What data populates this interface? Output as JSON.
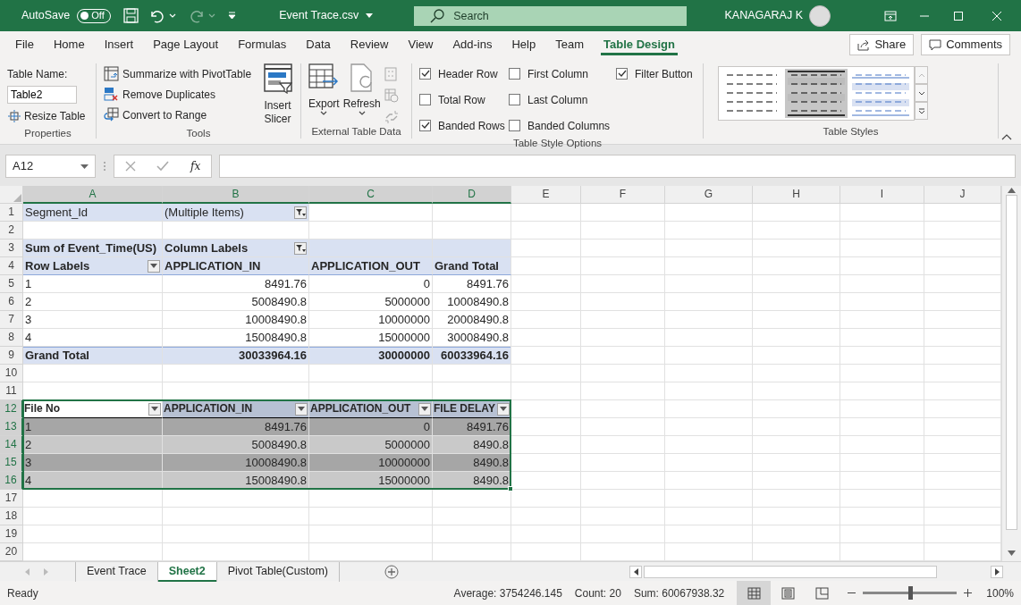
{
  "title_bar": {
    "autosave_label": "AutoSave",
    "autosave": {
      "on": false,
      "label": "Off"
    },
    "file_name": "Event Trace.csv",
    "search_placeholder": "Search",
    "user": "KANAGARAJ K"
  },
  "ribbon_tabs": [
    {
      "label": "File",
      "selected": false
    },
    {
      "label": "Home",
      "selected": false
    },
    {
      "label": "Insert",
      "selected": false
    },
    {
      "label": "Page Layout",
      "selected": false
    },
    {
      "label": "Formulas",
      "selected": false
    },
    {
      "label": "Data",
      "selected": false
    },
    {
      "label": "Review",
      "selected": false
    },
    {
      "label": "View",
      "selected": false
    },
    {
      "label": "Add-ins",
      "selected": false
    },
    {
      "label": "Help",
      "selected": false
    },
    {
      "label": "Team",
      "selected": false
    },
    {
      "label": "Table Design",
      "selected": true
    }
  ],
  "share": "Share",
  "comments": "Comments",
  "ribbon": {
    "properties": {
      "title": "Properties",
      "name_label": "Table Name:",
      "name_value": "Table2",
      "resize": "Resize Table"
    },
    "tools": {
      "title": "Tools",
      "items": [
        "Summarize with PivotTable",
        "Remove Duplicates",
        "Convert to Range"
      ],
      "slicer": "Insert Slicer"
    },
    "external": {
      "title": "External Table Data",
      "export": "Export",
      "refresh": "Refresh"
    },
    "style_options": {
      "title": "Table Style Options",
      "options": [
        {
          "label": "Header Row",
          "checked": true
        },
        {
          "label": "Total Row",
          "checked": false
        },
        {
          "label": "Banded Rows",
          "checked": true
        },
        {
          "label": "First Column",
          "checked": false
        },
        {
          "label": "Last Column",
          "checked": false
        },
        {
          "label": "Banded Columns",
          "checked": false
        },
        {
          "label": "Filter Button",
          "checked": true
        }
      ]
    },
    "table_styles": {
      "title": "Table Styles",
      "styles": [
        {
          "kind": "plain",
          "selected": false
        },
        {
          "kind": "gray",
          "selected": true
        },
        {
          "kind": "blue",
          "selected": false
        }
      ]
    }
  },
  "formula_bar": {
    "cell": "A12",
    "fx": "fx"
  },
  "columns": [
    {
      "label": "A",
      "selected": true
    },
    {
      "label": "B",
      "selected": true
    },
    {
      "label": "C",
      "selected": true
    },
    {
      "label": "D",
      "selected": true
    },
    {
      "label": "E",
      "selected": false
    },
    {
      "label": "F",
      "selected": false
    },
    {
      "label": "G",
      "selected": false
    },
    {
      "label": "H",
      "selected": false
    },
    {
      "label": "I",
      "selected": false
    },
    {
      "label": "J",
      "selected": false
    }
  ],
  "rows": [
    {
      "label": "1",
      "selected": false,
      "kind": "pivot-filter",
      "cells": [
        {
          "text": "Segment_Id",
          "kind": "text"
        },
        {
          "text": "(Multiple Items)",
          "kind": "text",
          "filter": {
            "kind": "funnel"
          }
        }
      ]
    },
    {
      "label": "2",
      "selected": false,
      "kind": "blank",
      "cells": []
    },
    {
      "label": "3",
      "selected": false,
      "kind": "pivot-head",
      "cells": [
        {
          "text": "Sum of Event_Time(US)",
          "kind": "text"
        },
        {
          "text": "Column Labels",
          "kind": "text",
          "filter": {
            "kind": "funnel"
          }
        }
      ]
    },
    {
      "label": "4",
      "selected": false,
      "kind": "pivot-labels",
      "cells": [
        {
          "text": "Row Labels",
          "kind": "text",
          "filter": {
            "kind": "dropdown"
          }
        },
        {
          "text": "APPLICATION_IN",
          "kind": "text"
        },
        {
          "text": "APPLICATION_OUT",
          "kind": "text"
        },
        {
          "text": "Grand Total",
          "kind": "text"
        }
      ]
    },
    {
      "label": "5",
      "selected": false,
      "kind": "pivot-data",
      "cells": [
        {
          "text": "1",
          "kind": "text"
        },
        {
          "text": "8491.76",
          "kind": "number"
        },
        {
          "text": "0",
          "kind": "number"
        },
        {
          "text": "8491.76",
          "kind": "number"
        }
      ]
    },
    {
      "label": "6",
      "selected": false,
      "kind": "pivot-data",
      "cells": [
        {
          "text": "2",
          "kind": "text"
        },
        {
          "text": "5008490.8",
          "kind": "number"
        },
        {
          "text": "5000000",
          "kind": "number"
        },
        {
          "text": "10008490.8",
          "kind": "number"
        }
      ]
    },
    {
      "label": "7",
      "selected": false,
      "kind": "pivot-data",
      "cells": [
        {
          "text": "3",
          "kind": "text"
        },
        {
          "text": "10008490.8",
          "kind": "number"
        },
        {
          "text": "10000000",
          "kind": "number"
        },
        {
          "text": "20008490.8",
          "kind": "number"
        }
      ]
    },
    {
      "label": "8",
      "selected": false,
      "kind": "pivot-data",
      "cells": [
        {
          "text": "4",
          "kind": "text"
        },
        {
          "text": "15008490.8",
          "kind": "number"
        },
        {
          "text": "15000000",
          "kind": "number"
        },
        {
          "text": "30008490.8",
          "kind": "number"
        }
      ]
    },
    {
      "label": "9",
      "selected": false,
      "kind": "pivot-total",
      "cells": [
        {
          "text": "Grand Total",
          "kind": "text"
        },
        {
          "text": "30033964.16",
          "kind": "number"
        },
        {
          "text": "30000000",
          "kind": "number"
        },
        {
          "text": "60033964.16",
          "kind": "number"
        }
      ]
    },
    {
      "label": "10",
      "selected": false,
      "kind": "blank",
      "cells": []
    },
    {
      "label": "11",
      "selected": false,
      "kind": "blank",
      "cells": []
    },
    {
      "label": "12",
      "selected": true,
      "kind": "table-header",
      "cells": [
        {
          "text": "File No",
          "kind": "text",
          "active": true,
          "filter": {
            "kind": "dropdown"
          }
        },
        {
          "text": "APPLICATION_IN",
          "kind": "text",
          "active": false,
          "filter": {
            "kind": "dropdown"
          }
        },
        {
          "text": "APPLICATION_OUT",
          "kind": "text",
          "active": false,
          "filter": {
            "kind": "dropdown"
          }
        },
        {
          "text": "FILE DELAY",
          "kind": "text",
          "active": false,
          "filter": {
            "kind": "dropdown"
          }
        }
      ]
    },
    {
      "label": "13",
      "selected": true,
      "kind": "band-dark",
      "cells": [
        {
          "text": "1",
          "kind": "text"
        },
        {
          "text": "8491.76",
          "kind": "number"
        },
        {
          "text": "0",
          "kind": "number"
        },
        {
          "text": "8491.76",
          "kind": "number"
        }
      ]
    },
    {
      "label": "14",
      "selected": true,
      "kind": "band-light",
      "cells": [
        {
          "text": "2",
          "kind": "text"
        },
        {
          "text": "5008490.8",
          "kind": "number"
        },
        {
          "text": "5000000",
          "kind": "number"
        },
        {
          "text": "8490.8",
          "kind": "number"
        }
      ]
    },
    {
      "label": "15",
      "selected": true,
      "kind": "band-dark",
      "cells": [
        {
          "text": "3",
          "kind": "text"
        },
        {
          "text": "10008490.8",
          "kind": "number"
        },
        {
          "text": "10000000",
          "kind": "number"
        },
        {
          "text": "8490.8",
          "kind": "number"
        }
      ]
    },
    {
      "label": "16",
      "selected": true,
      "kind": "band-light",
      "cells": [
        {
          "text": "4",
          "kind": "text"
        },
        {
          "text": "15008490.8",
          "kind": "number"
        },
        {
          "text": "15000000",
          "kind": "number"
        },
        {
          "text": "8490.8",
          "kind": "number"
        }
      ]
    },
    {
      "label": "17",
      "selected": false,
      "kind": "blank",
      "cells": []
    },
    {
      "label": "18",
      "selected": false,
      "kind": "blank",
      "cells": []
    },
    {
      "label": "19",
      "selected": false,
      "kind": "blank",
      "cells": []
    },
    {
      "label": "20",
      "selected": false,
      "kind": "blank",
      "cells": []
    }
  ],
  "sheet_tabs": [
    {
      "label": "Event Trace",
      "selected": false
    },
    {
      "label": "Sheet2",
      "selected": true
    },
    {
      "label": "Pivot Table(Custom)",
      "selected": false
    }
  ],
  "status_bar": {
    "state": "Ready",
    "stats": [
      "Average: 3754246.145",
      "Count: 20",
      "Sum: 60067938.32"
    ],
    "views": [
      {
        "kind": "normal",
        "selected": true
      },
      {
        "kind": "page-layout",
        "selected": false
      },
      {
        "kind": "page-break",
        "selected": false
      }
    ],
    "zoom": {
      "level": 0.5,
      "label": "100%"
    }
  }
}
